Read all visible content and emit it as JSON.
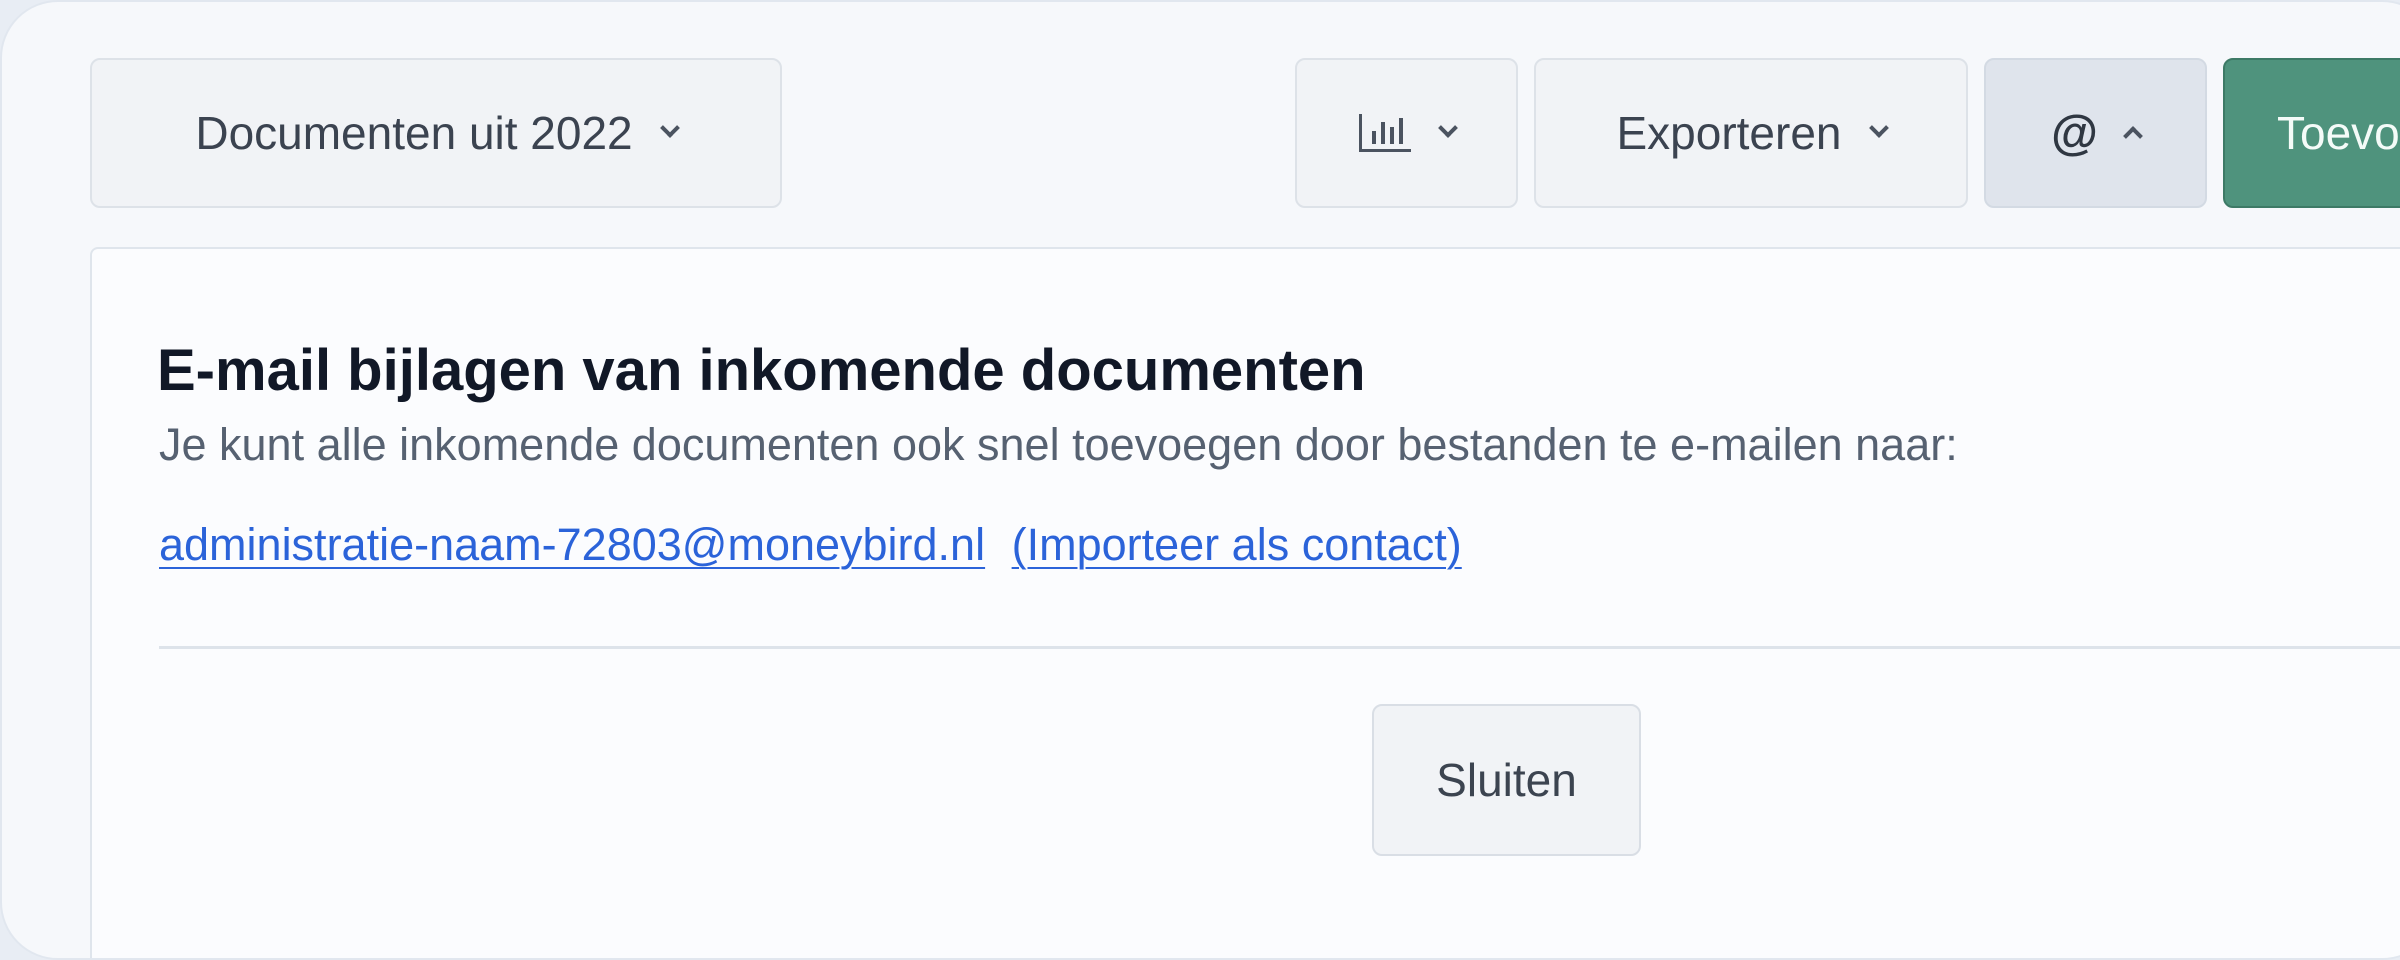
{
  "toolbar": {
    "filter_label": "Documenten uit 2022",
    "chart_icon": "bar-chart-icon",
    "export_label": "Exporteren",
    "email_icon": "at-sign-icon",
    "email_symbol": "@",
    "add_label": "Toevo"
  },
  "panel": {
    "title": "E-mail bijlagen van inkomende documenten",
    "description": "Je kunt alle inkomende documenten ook snel toevoegen door bestanden te e-mailen naar:",
    "email_address": "administratie-naam-72803@moneybird.nl",
    "import_link": "(Importeer als contact)",
    "close_label": "Sluiten"
  },
  "colors": {
    "background": "#f6f8fb",
    "primary": "#4f937d",
    "link": "#2b63d9"
  }
}
